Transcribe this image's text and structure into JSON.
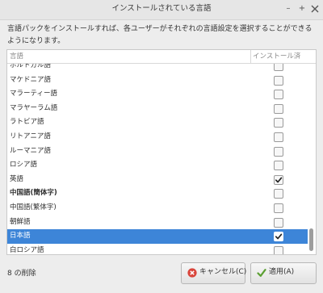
{
  "window": {
    "title": "インストールされている言語",
    "minimize_glyph": "–",
    "maximize_glyph": "+"
  },
  "description": "言語パックをインストールすれば、各ユーザーがそれぞれの言語設定を選択することができるようになります。",
  "table": {
    "headers": {
      "name": "言語",
      "installed": "インストール済"
    },
    "rows": [
      {
        "name": "ポルトガル語",
        "checked": false,
        "bold": false,
        "selected": false
      },
      {
        "name": "マケドニア語",
        "checked": false,
        "bold": false,
        "selected": false
      },
      {
        "name": "マラーティー語",
        "checked": false,
        "bold": false,
        "selected": false
      },
      {
        "name": "マラヤーラム語",
        "checked": false,
        "bold": false,
        "selected": false
      },
      {
        "name": "ラトビア語",
        "checked": false,
        "bold": false,
        "selected": false
      },
      {
        "name": "リトアニア語",
        "checked": false,
        "bold": false,
        "selected": false
      },
      {
        "name": "ルーマニア語",
        "checked": false,
        "bold": false,
        "selected": false
      },
      {
        "name": "ロシア語",
        "checked": false,
        "bold": false,
        "selected": false
      },
      {
        "name": "英語",
        "checked": true,
        "bold": false,
        "selected": false
      },
      {
        "name": "中国語(簡体字)",
        "checked": false,
        "bold": true,
        "selected": false
      },
      {
        "name": "中国語(繁体字)",
        "checked": false,
        "bold": false,
        "selected": false
      },
      {
        "name": "朝鮮語",
        "checked": false,
        "bold": false,
        "selected": false
      },
      {
        "name": "日本語",
        "checked": true,
        "bold": false,
        "selected": true
      },
      {
        "name": "白ロシア語",
        "checked": false,
        "bold": false,
        "selected": false
      }
    ]
  },
  "status": "8 の削除",
  "buttons": {
    "cancel": "キャンセル(C)",
    "apply": "適用(A)"
  },
  "colors": {
    "selection": "#3d85d8",
    "cancel_icon": "#d9453b",
    "apply_icon": "#5ca033"
  },
  "icons": {
    "cancel": "cancel-circle-icon",
    "apply": "check-icon"
  }
}
